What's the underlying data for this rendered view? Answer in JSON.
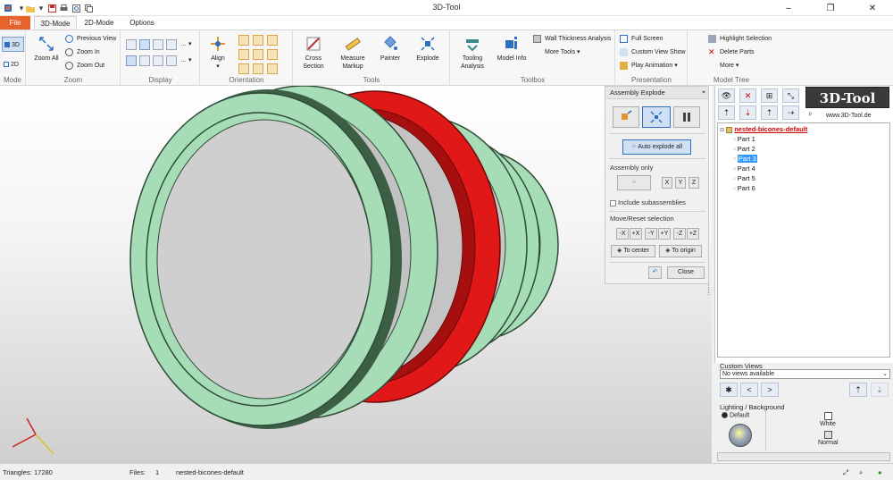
{
  "window": {
    "title": "3D-Tool"
  },
  "tabs": [
    "File",
    "3D-Mode",
    "2D-Mode",
    "Options"
  ],
  "ribbon": {
    "mode": {
      "label": "Mode",
      "buttons": [
        "3D",
        "2D"
      ]
    },
    "zoom": {
      "label": "Zoom",
      "zoom_all": "Zoom All",
      "previous_view": "Previous View",
      "zoom_in": "Zoom In",
      "zoom_out": "Zoom Out"
    },
    "display": {
      "label": "Display"
    },
    "orientation": {
      "label": "Orientation",
      "align": "Align"
    },
    "tools": {
      "label": "Tools",
      "cross_section": "Cross Section",
      "measure_markup": "Measure Markup",
      "painter": "Painter",
      "explode": "Explode"
    },
    "toolbox": {
      "label": "Toolbox",
      "tooling_analysis": "Tooling Analysis",
      "model_info": "Model Info",
      "wall_thickness": "Wall Thickness Analysis",
      "more_tools": "More Tools"
    },
    "presentation": {
      "label": "Presentation",
      "full_screen": "Full Screen",
      "custom_view_show": "Custom View Show",
      "play_animation": "Play Animation"
    },
    "model_tree": {
      "label": "Model Tree",
      "highlight_selection": "Highlight Selection",
      "delete_parts": "Delete Parts",
      "more": "More"
    }
  },
  "explode_panel": {
    "title": "Assembly Explode",
    "auto_explode": "Auto explode all",
    "assembly_only": "Assembly only",
    "axis_buttons": [
      "X",
      "Y",
      "Z"
    ],
    "include_subassemblies": "Include subassemblies",
    "move_reset": "Move/Reset selection",
    "move_buttons": [
      "-X",
      "+X",
      "-Y",
      "+Y",
      "-Z",
      "+Z"
    ],
    "to_center": "To center",
    "to_origin": "To origin",
    "close": "Close"
  },
  "model_tree": {
    "logo_text": "3D-Tool",
    "logo_url": "www.3D-Tool.de",
    "root": "nested-bicones-default",
    "parts": [
      "Part 1",
      "Part 2",
      "Part 3",
      "Part 4",
      "Part 5",
      "Part 6"
    ],
    "selected_part": "Part 3"
  },
  "custom_views": {
    "title": "Custom Views",
    "placeholder": "No views available"
  },
  "lighting": {
    "title": "Lighting / Background",
    "default": "Default",
    "white": "White",
    "normal": "Normal"
  },
  "status": {
    "triangles_label": "Triangles:",
    "triangles": "17280",
    "files_label": "Files:",
    "files": "1",
    "filename": "nested-bicones-default"
  },
  "colors": {
    "ring_green": "#a6dcb6",
    "ring_dark": "#3b5e45",
    "ring_red": "#e01818",
    "accent_orange": "#e8632c",
    "selection_blue": "#3399ff"
  }
}
